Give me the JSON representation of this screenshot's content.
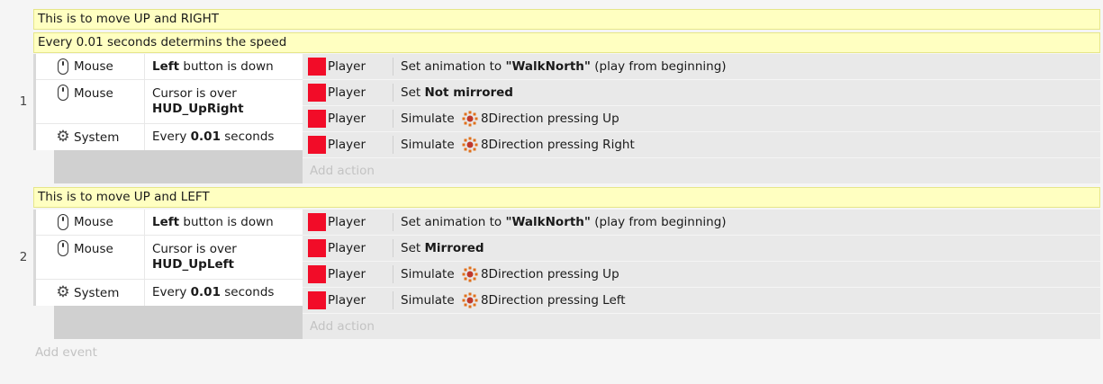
{
  "events": [
    {
      "number": "1",
      "comments": [
        "This is to move UP and RIGHT",
        "Every 0.01 seconds determins the speed"
      ],
      "conditions": [
        {
          "icon": "mouse-icon",
          "object": "Mouse",
          "pre": "",
          "bold": "Left",
          "post": " button is down"
        },
        {
          "icon": "mouse-icon",
          "object": "Mouse",
          "line1": "Cursor is over",
          "line2": "HUD_UpRight"
        },
        {
          "icon": "gear-icon",
          "object": "System",
          "pre": "Every ",
          "bold": "0.01",
          "post": " seconds"
        }
      ],
      "actions": [
        {
          "object": "Player",
          "pre": "Set animation to ",
          "bold": "\"WalkNorth\"",
          "post": " (play from beginning)"
        },
        {
          "object": "Player",
          "pre": "Set ",
          "bold": "Not mirrored",
          "post": ""
        },
        {
          "object": "Player",
          "pre": "Simulate ",
          "behavior": "8Direction",
          "post": " pressing Up"
        },
        {
          "object": "Player",
          "pre": "Simulate ",
          "behavior": "8Direction",
          "post": " pressing Right"
        }
      ],
      "add_action": "Add action"
    },
    {
      "number": "2",
      "comments": [
        "This is to move UP and LEFT"
      ],
      "conditions": [
        {
          "icon": "mouse-icon",
          "object": "Mouse",
          "pre": "",
          "bold": "Left",
          "post": " button is down"
        },
        {
          "icon": "mouse-icon",
          "object": "Mouse",
          "line1": "Cursor is over",
          "line2": "HUD_UpLeft"
        },
        {
          "icon": "gear-icon",
          "object": "System",
          "pre": "Every ",
          "bold": "0.01",
          "post": " seconds"
        }
      ],
      "actions": [
        {
          "object": "Player",
          "pre": "Set animation to ",
          "bold": "\"WalkNorth\"",
          "post": " (play from beginning)"
        },
        {
          "object": "Player",
          "pre": "Set ",
          "bold": "Mirrored",
          "post": ""
        },
        {
          "object": "Player",
          "pre": "Simulate ",
          "behavior": "8Direction",
          "post": " pressing Up"
        },
        {
          "object": "Player",
          "pre": "Simulate ",
          "behavior": "8Direction",
          "post": " pressing Left"
        }
      ],
      "add_action": "Add action"
    }
  ],
  "add_event": "Add event",
  "colors": {
    "comment_bg": "#ffffc1",
    "player_swatch": "#f20c28",
    "action_bg": "#e9e9e9"
  }
}
